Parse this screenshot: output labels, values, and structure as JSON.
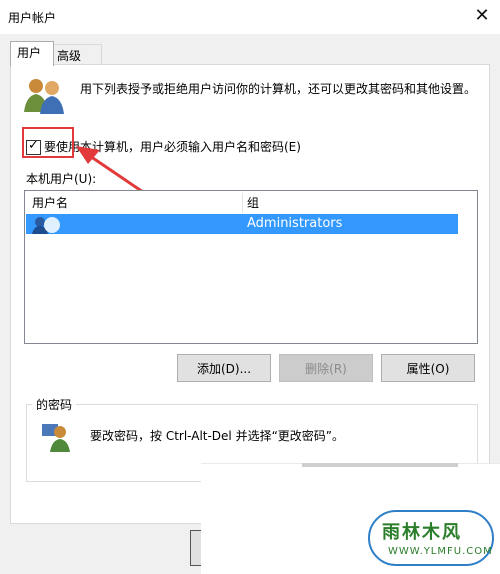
{
  "window": {
    "title": "用户帐户",
    "close_label": "✕"
  },
  "tabs": [
    {
      "label": "用户"
    },
    {
      "label": "高级"
    }
  ],
  "description": "用下列表授予或拒绝用户访问你的计算机，还可以更改其密码和其他设置。",
  "checkbox": {
    "label": "要使用本计算机，用户必须输入用户名和密码(E)",
    "checked": true,
    "mark": "✓"
  },
  "users_list": {
    "label": "本机用户(U):",
    "columns": [
      "用户名",
      "组"
    ],
    "rows": [
      {
        "username": "",
        "group": "Administrators",
        "selected": true
      }
    ]
  },
  "buttons": {
    "add": "添加(D)...",
    "remove": "删除(R)",
    "properties": "属性(O)"
  },
  "password_group": {
    "label": "的密码",
    "text": "要改密码，按 Ctrl-Alt-Del 并选择“更改密码”。"
  },
  "watermark": {
    "main": "雨林木风",
    "sub": "WWW.YLMFU.COM"
  },
  "colors": {
    "selection": "#3399ff",
    "annotation": "#e23a3a"
  }
}
